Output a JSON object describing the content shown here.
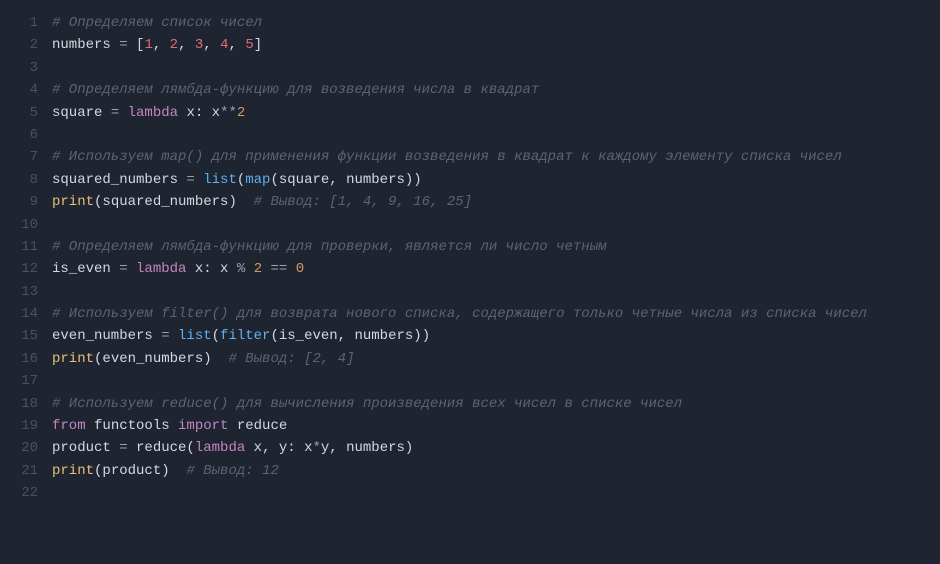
{
  "lines": {
    "l1_comment": "# Определяем список чисел",
    "l2_a": "numbers ",
    "l2_b": "=",
    "l2_c": " [",
    "l2_d": "1",
    "l2_e": ", ",
    "l2_f": "2",
    "l2_g": ", ",
    "l2_h": "3",
    "l2_i": ", ",
    "l2_j": "4",
    "l2_k": ", ",
    "l2_l": "5",
    "l2_m": "]",
    "l4_comment": "# Определяем лямбда-функцию для возведения числа в квадрат",
    "l5_a": "square ",
    "l5_b": "=",
    "l5_c": " ",
    "l5_d": "lambda",
    "l5_e": " x: x",
    "l5_f": "**",
    "l5_g": "2",
    "l7_comment": "# Используем map() для применения функции возведения в квадрат к каждому элементу списка чисел",
    "l8_a": "squared_numbers ",
    "l8_b": "=",
    "l8_c": " ",
    "l8_d": "list",
    "l8_e": "(",
    "l8_f": "map",
    "l8_g": "(square, numbers))",
    "l9_a": "print",
    "l9_b": "(squared_numbers)",
    "l9_c": "  # Вывод: [1, 4, 9, 16, 25]",
    "l11_comment": "# Определяем лямбда-функцию для проверки, является ли число четным",
    "l12_a": "is_even ",
    "l12_b": "=",
    "l12_c": " ",
    "l12_d": "lambda",
    "l12_e": " x: x ",
    "l12_f": "%",
    "l12_g": " ",
    "l12_h": "2",
    "l12_i": " ",
    "l12_j": "==",
    "l12_k": " ",
    "l12_l": "0",
    "l14_comment": "# Используем filter() для возврата нового списка, содержащего только четные числа из списка чисел",
    "l15_a": "even_numbers ",
    "l15_b": "=",
    "l15_c": " ",
    "l15_d": "list",
    "l15_e": "(",
    "l15_f": "filter",
    "l15_g": "(is_even, numbers))",
    "l16_a": "print",
    "l16_b": "(even_numbers)",
    "l16_c": "  # Вывод: [2, 4]",
    "l18_comment": "# Используем reduce() для вычисления произведения всех чисел в списке чисел",
    "l19_a": "from",
    "l19_b": " functools ",
    "l19_c": "import",
    "l19_d": " reduce",
    "l20_a": "product ",
    "l20_b": "=",
    "l20_c": " reduce(",
    "l20_d": "lambda",
    "l20_e": " x, y: x",
    "l20_f": "*",
    "l20_g": "y, numbers)",
    "l21_a": "print",
    "l21_b": "(product)",
    "l21_c": "  # Вывод: 12"
  },
  "linenos": {
    "n1": "1",
    "n2": "2",
    "n3": "3",
    "n4": "4",
    "n5": "5",
    "n6": "6",
    "n7": "7",
    "n8": "8",
    "n9": "9",
    "n10": "10",
    "n11": "11",
    "n12": "12",
    "n13": "13",
    "n14": "14",
    "n15": "15",
    "n16": "16",
    "n17": "17",
    "n18": "18",
    "n19": "19",
    "n20": "20",
    "n21": "21",
    "n22": "22"
  }
}
